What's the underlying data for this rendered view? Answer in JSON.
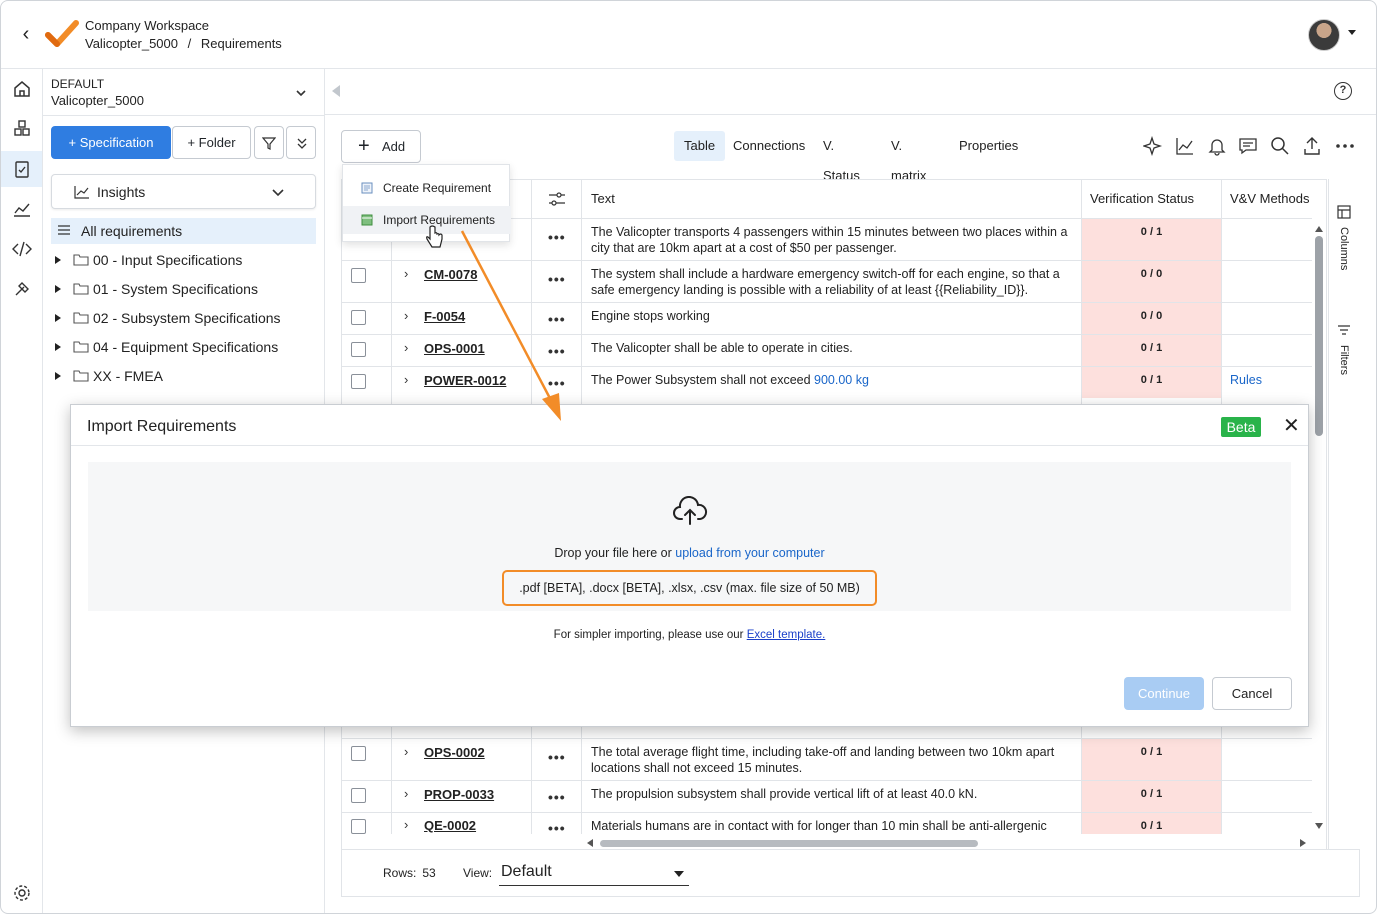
{
  "header": {
    "workspace": "Company Workspace",
    "project": "Valicopter_5000",
    "separator": "/",
    "page": "Requirements"
  },
  "sidebar": {
    "default_label": "DEFAULT",
    "project": "Valicopter_5000",
    "specification_button": "+ Specification",
    "folder_button": "+ Folder",
    "insights": "Insights",
    "all_requirements": "All requirements",
    "tree": [
      {
        "label": "00 - Input Specifications"
      },
      {
        "label": "01 - System Specifications"
      },
      {
        "label": "02 - Subsystem Specifications"
      },
      {
        "label": "04 - Equipment Specifications"
      },
      {
        "label": "XX - FMEA"
      }
    ]
  },
  "toolbar": {
    "add": "Add",
    "views": [
      "Table",
      "Connections",
      "V. Status",
      "V. matrix",
      "Properties"
    ],
    "active_view": "Table"
  },
  "add_menu": {
    "items": [
      "Create Requirement",
      "Import Requirements"
    ]
  },
  "table": {
    "columns": {
      "text": "Text",
      "verification_status": "Verification Status",
      "vv_methods": "V&V Methods"
    },
    "rows": [
      {
        "id": "",
        "text": "The Valicopter transports 4 passengers within 15 minutes between two places within a city that are 10km apart at a cost of $50 per passenger.",
        "status": "0 / 1",
        "vv": ""
      },
      {
        "id": "CM-0078",
        "text": "The system shall include a hardware emergency switch-off for each engine, so that a safe emergency landing is possible with a reliability of at least {{Reliability_ID}}.",
        "status": "0 / 0",
        "vv": ""
      },
      {
        "id": "F-0054",
        "text": "Engine stops working",
        "status": "0 / 0",
        "vv": ""
      },
      {
        "id": "OPS-0001",
        "text": "The Valicopter shall be able to operate in cities.",
        "status": "0 / 1",
        "vv": ""
      },
      {
        "id": "POWER-0012",
        "text_prefix": "The Power Subsystem shall not exceed ",
        "text_value": "900.00  kg",
        "status": "0 / 1",
        "vv": "Rules"
      },
      {
        "id": "OPS-0002",
        "text": "The total average flight time, including take-off and landing between two 10km apart locations shall not exceed 15 minutes.",
        "status": "0 / 1",
        "vv": ""
      },
      {
        "id": "PROP-0033",
        "text": "The propulsion subsystem shall provide vertical lift of at least 40.0 kN.",
        "status": "0 / 1",
        "vv": ""
      },
      {
        "id": "QE-0002",
        "text": "Materials humans are in contact with for longer than 10 min shall be anti-allergenic",
        "status": "0 / 1",
        "vv": ""
      }
    ]
  },
  "footer": {
    "rows_label": "Rows:",
    "rows_value": "53",
    "view_label": "View:",
    "view_value": "Default"
  },
  "right_panel": {
    "columns": "Columns",
    "filters": "Filters"
  },
  "modal": {
    "title": "Import Requirements",
    "badge": "Beta",
    "drop_text": "Drop your file here or ",
    "drop_link": "upload from your computer",
    "formats": ".pdf [BETA], .docx [BETA], .xlsx, .csv (max. file size of 50 MB)",
    "simpler_text": "For simpler importing, please use our ",
    "simpler_link": "Excel template.",
    "continue": "Continue",
    "cancel": "Cancel"
  },
  "colors": {
    "primary": "#2f7de1",
    "status_bg": "#fde0dd",
    "beta": "#29b34a",
    "annotation": "#f28c28",
    "link": "#1a66c9"
  }
}
